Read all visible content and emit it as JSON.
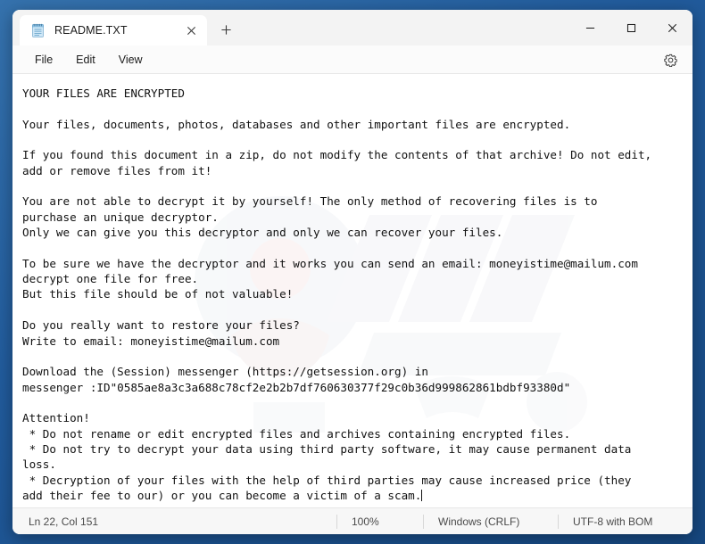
{
  "window": {
    "tab_title": "README.TXT",
    "tab_icon": "notepad-icon",
    "close_tab_glyph": "✕",
    "new_tab_glyph": "＋",
    "minimize_glyph": "—",
    "maximize_glyph": "▢",
    "close_glyph": "✕"
  },
  "menubar": {
    "items": [
      {
        "label": "File"
      },
      {
        "label": "Edit"
      },
      {
        "label": "View"
      }
    ],
    "settings_icon": "gear-icon"
  },
  "document": {
    "lines": [
      "YOUR FILES ARE ENCRYPTED",
      "",
      "Your files, documents, photos, databases and other important files are encrypted.",
      "",
      "If you found this document in a zip, do not modify the contents of that archive! Do not edit,",
      "add or remove files from it!",
      "",
      "You are not able to decrypt it by yourself! The only method of recovering files is to",
      "purchase an unique decryptor.",
      "Only we can give you this decryptor and only we can recover your files.",
      "",
      "To be sure we have the decryptor and it works you can send an email: moneyistime@mailum.com",
      "decrypt one file for free.",
      "But this file should be of not valuable!",
      "",
      "Do you really want to restore your files?",
      "Write to email: moneyistime@mailum.com",
      "",
      "Download the (Session) messenger (https://getsession.org) in",
      "messenger :ID\"0585ae8a3c3a688c78cf2e2b2b7df760630377f29c0b36d999862861bdbf93380d\"",
      "",
      "Attention!",
      " * Do not rename or edit encrypted files and archives containing encrypted files.",
      " * Do not try to decrypt your data using third party software, it may cause permanent data",
      "loss.",
      " * Decryption of your files with the help of third parties may cause increased price (they",
      "add their fee to our) or you can become a victim of a scam."
    ],
    "contact_email": "moneyistime@mailum.com",
    "session_url": "https://getsession.org",
    "session_id": "0585ae8a3c3a688c78cf2e2b2b7df760630377f29c0b36d999862861bdbf93380d"
  },
  "statusbar": {
    "cursor_position": "Ln 22, Col 151",
    "zoom": "100%",
    "line_ending": "Windows (CRLF)",
    "encoding": "UTF-8 with BOM"
  },
  "colors": {
    "desktop": "#215b9c",
    "window_bg": "#ffffff",
    "titlebar_bg": "#f3f3f3",
    "text": "#111111",
    "status_text": "#4a4a4a"
  }
}
